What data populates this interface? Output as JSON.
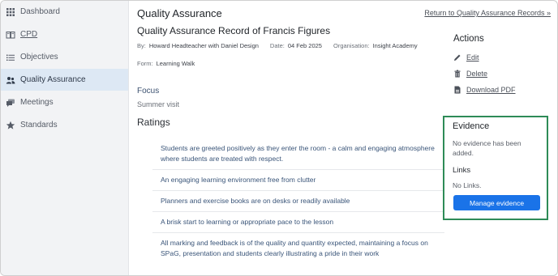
{
  "sidebar": {
    "items": [
      {
        "label": "Dashboard",
        "icon": "grid-icon"
      },
      {
        "label": "CPD",
        "icon": "book-icon"
      },
      {
        "label": "Objectives",
        "icon": "list-icon"
      },
      {
        "label": "Quality Assurance",
        "icon": "users-icon",
        "active": true
      },
      {
        "label": "Meetings",
        "icon": "chat-icon"
      },
      {
        "label": "Standards",
        "icon": "star-icon"
      }
    ]
  },
  "header": {
    "title": "Quality Assurance",
    "return_link": "Return to Quality Assurance Records »"
  },
  "record": {
    "title": "Quality Assurance Record of Francis Figures",
    "by_label": "By:",
    "by_value": "Howard Headteacher with Daniel Design",
    "date_label": "Date:",
    "date_value": "04 Feb 2025",
    "org_label": "Organisation:",
    "org_value": "Insight Academy",
    "form_label": "Form:",
    "form_value": "Learning Walk",
    "focus_label": "Focus",
    "focus_value": "Summer visit"
  },
  "ratings": {
    "title": "Ratings",
    "items": [
      "Students are greeted positively as they enter the room - a calm and engaging atmosphere where students are treated with respect.",
      "An engaging learning environment free from clutter",
      "Planners and exercise books are on desks or readily available",
      "A brisk start to learning or appropriate pace to the lesson",
      "All marking and feedback is of the quality and quantity expected, maintaining a focus on SPaG, presentation and students clearly illustrating a pride in their work"
    ]
  },
  "actions": {
    "title": "Actions",
    "edit": "Edit",
    "delete": "Delete",
    "download": "Download PDF"
  },
  "evidence": {
    "title": "Evidence",
    "empty_text": "No evidence has been added.",
    "links_title": "Links",
    "links_empty": "No Links.",
    "manage_button": "Manage evidence"
  },
  "colors": {
    "accent": "#1a73e8",
    "evidence_border": "#2e8b57",
    "sidebar_active": "#dde8f4"
  }
}
